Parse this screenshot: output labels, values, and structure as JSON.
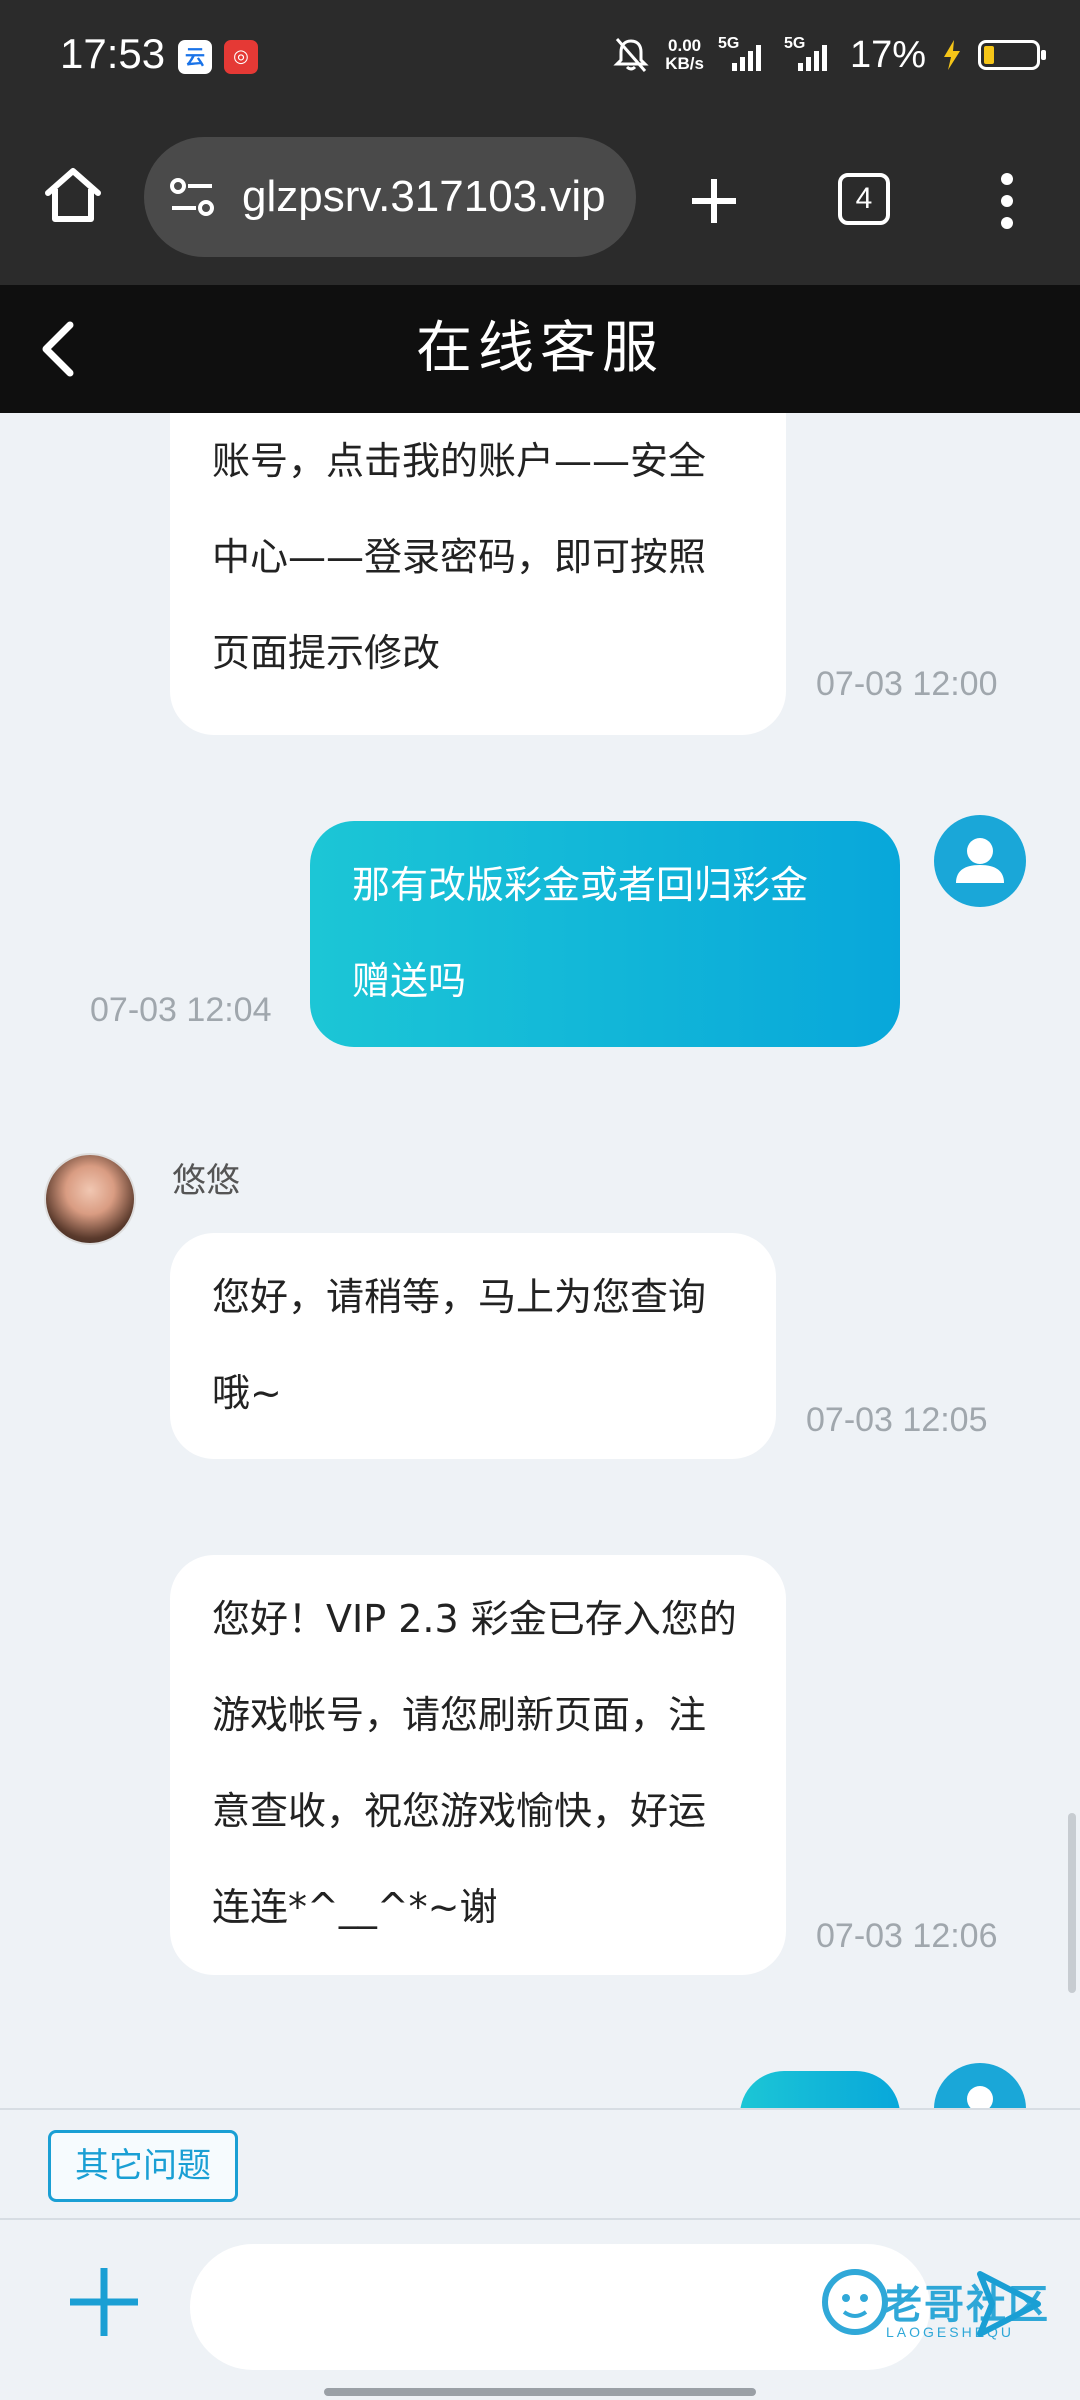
{
  "status_bar": {
    "time": "17:53",
    "net_speed": "0.00",
    "net_unit": "KB/s",
    "sim1": "5G",
    "sim2": "5G",
    "battery": "17%"
  },
  "browser": {
    "url": "glzpsrv.317103.vip",
    "tab_count": "4"
  },
  "header": {
    "title": "在线客服"
  },
  "chat": {
    "messages": [
      {
        "side": "agent",
        "lines": [
          "账号，点击我的账户——安全",
          "中心——登录密码，即可按照",
          "页面提示修改"
        ],
        "time": "07-03 12:00"
      },
      {
        "side": "user",
        "lines": [
          "那有改版彩金或者回归彩金",
          "赠送吗"
        ],
        "time": "07-03 12:04"
      },
      {
        "side": "agent",
        "name": "悠悠",
        "lines": [
          "您好，请稍等，马上为您查询",
          "哦~"
        ],
        "time": "07-03 12:05"
      },
      {
        "side": "agent",
        "lines": [
          "您好！VIP 2.3 彩金已存入您的",
          "游戏帐号，请您刷新页面，注",
          "意查收，祝您游戏愉快，好运",
          "连连*^__^*~谢"
        ],
        "time": "07-03 12:06"
      }
    ]
  },
  "quick": {
    "other_questions": "其它问题"
  },
  "input": {
    "placeholder": ""
  },
  "watermark": {
    "text": "老哥社区",
    "sub": "LAOGESHEQU"
  },
  "colors": {
    "accent": "#1a9fd4",
    "user_bubble_start": "#1cc6d6",
    "user_bubble_end": "#08a7da",
    "header_bg": "#0f0f0f"
  }
}
